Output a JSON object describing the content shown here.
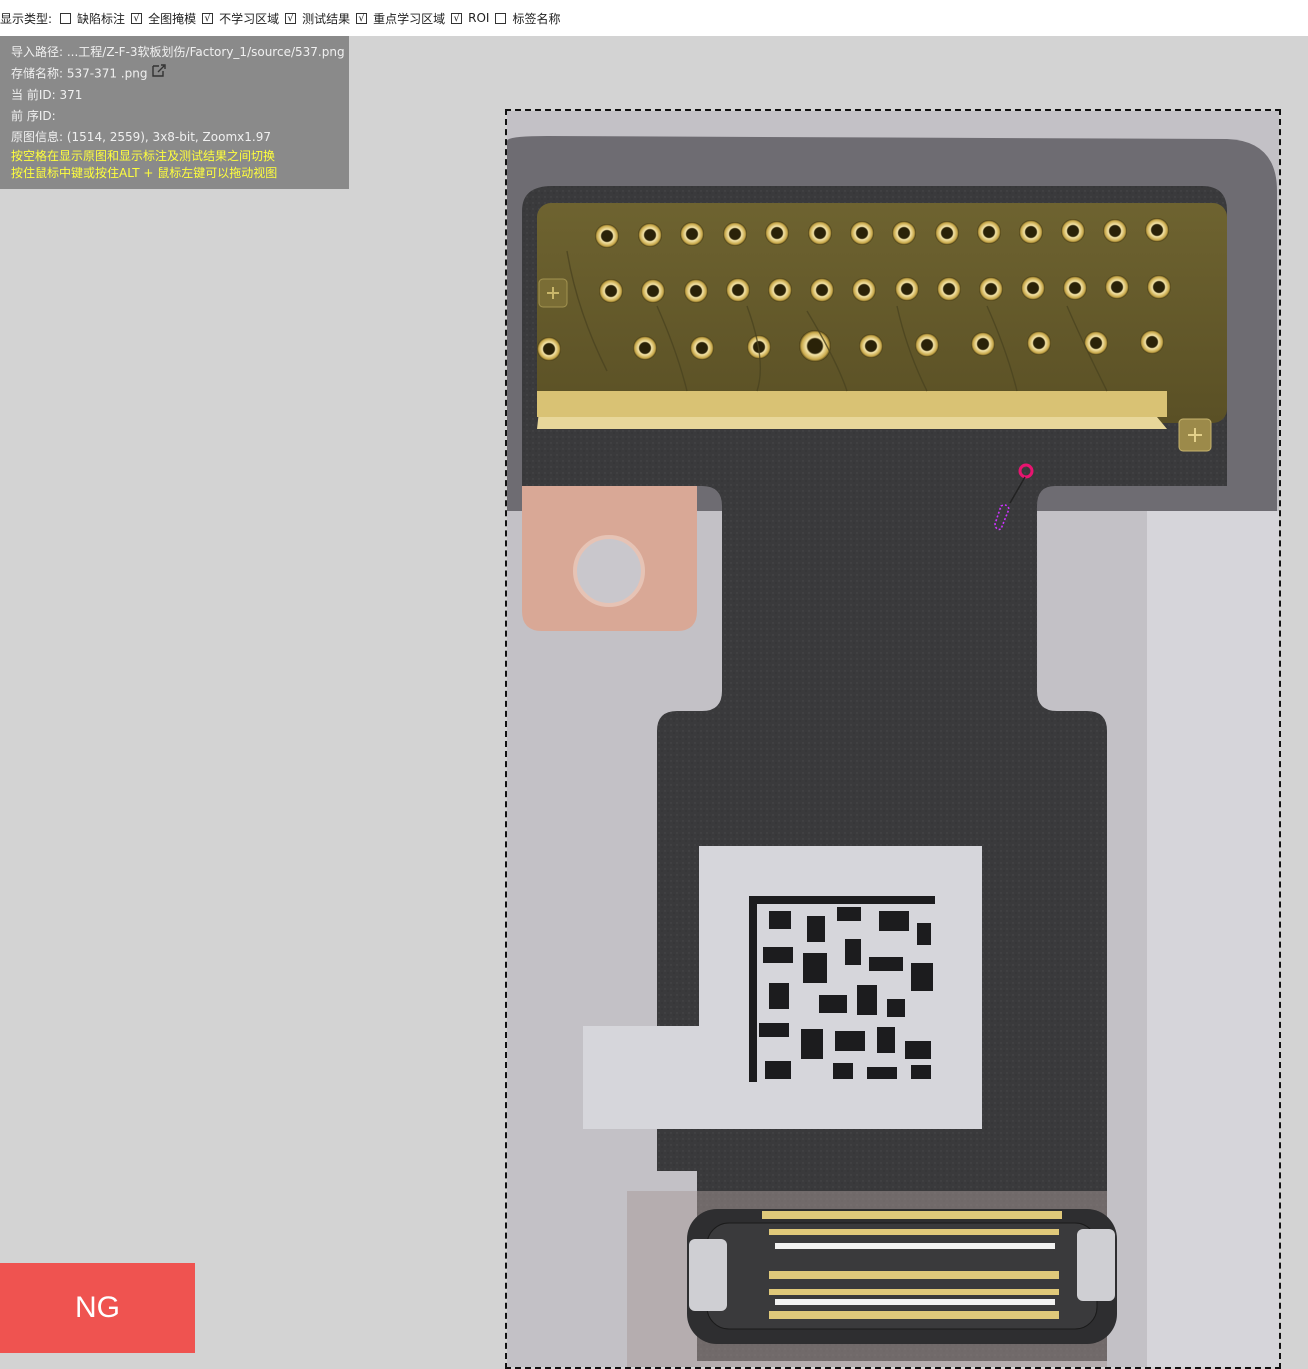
{
  "toolbar": {
    "label": "显示类型:",
    "options": [
      {
        "label": "缺陷标注",
        "checked": false
      },
      {
        "label": "全图掩模",
        "checked": true
      },
      {
        "label": "不学习区域",
        "checked": true
      },
      {
        "label": "测试结果",
        "checked": true
      },
      {
        "label": "重点学习区域",
        "checked": true
      },
      {
        "label": "ROI",
        "checked": true
      },
      {
        "label": "标签名称",
        "checked": false
      }
    ]
  },
  "info": {
    "import_path": "导入路径: ...工程/Z-F-3软板划伤/Factory_1/source/537.png",
    "save_name": "存储名称: 537-371 .png",
    "current_id": "当 前ID: 371",
    "prev_id": "前 序ID:",
    "image_info": "原图信息: (1514, 2559), 3x8-bit, Zoomx1.97",
    "hint1": "按空格在显示原图和显示标注及测试结果之间切换",
    "hint2": "按住鼠标中键或按住ALT + 鼠标左键可以拖动视图"
  },
  "result": {
    "label": "NG",
    "color": "#ef5350"
  },
  "colors": {
    "background": "#d3d3d3",
    "panel": "#8a8a8a",
    "hint": "#ffff3c",
    "defect_marker": "#e81470",
    "defect_outline": "#cc33ff"
  },
  "icons": {
    "edit": "edit-icon"
  }
}
